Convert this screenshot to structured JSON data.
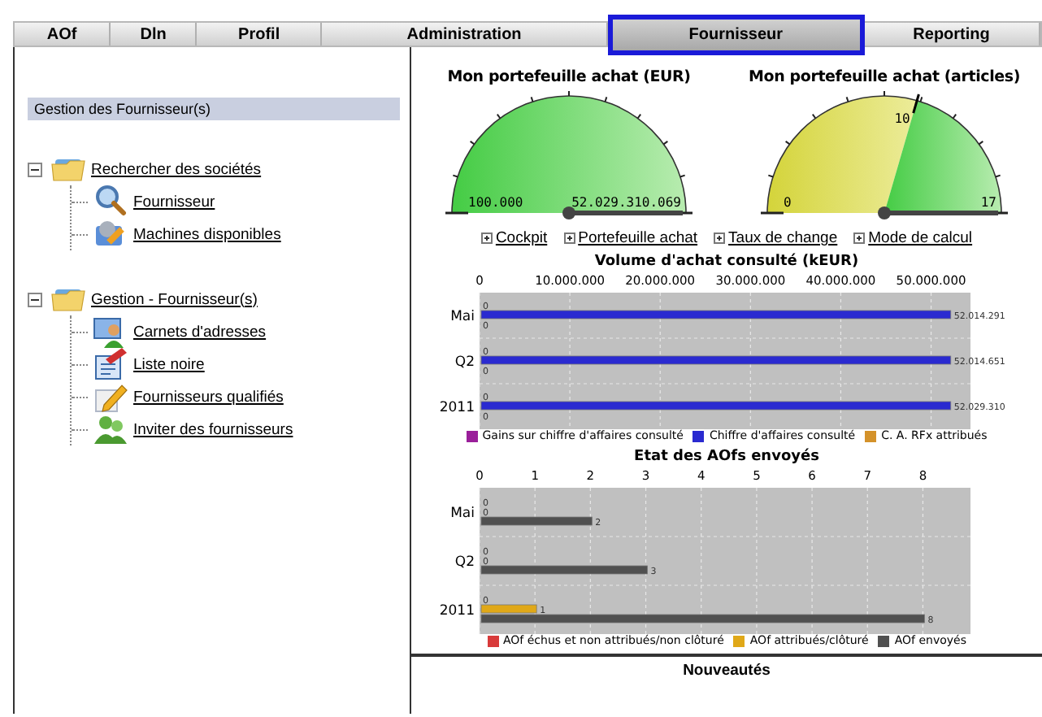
{
  "tabs": [
    {
      "label": "AOf",
      "selected": false
    },
    {
      "label": "Dln",
      "selected": false
    },
    {
      "label": "Profil",
      "selected": false
    },
    {
      "label": "Administration",
      "selected": false
    },
    {
      "label": "Fournisseur",
      "selected": true
    },
    {
      "label": "Reporting",
      "selected": false
    }
  ],
  "sidebar": {
    "title": "Gestion des Fournisseur(s)",
    "groups": [
      {
        "label": "Rechercher des sociétés",
        "expanded": true,
        "children": [
          {
            "label": "Fournisseur"
          },
          {
            "label": "Machines disponibles"
          }
        ]
      },
      {
        "label": "Gestion - Fournisseur(s)",
        "expanded": true,
        "children": [
          {
            "label": "Carnets d'adresses"
          },
          {
            "label": "Liste noire"
          },
          {
            "label": "Fournisseurs qualifiés"
          },
          {
            "label": "Inviter des fournisseurs"
          }
        ]
      }
    ]
  },
  "gauges": [
    {
      "title": "Mon portefeuille achat (EUR)",
      "min_label": "100.000",
      "max_label": "52.029.310.069"
    },
    {
      "title": "Mon portefeuille achat (articles)",
      "min_label": "0",
      "max_label": "17",
      "zone": {
        "label": "10"
      }
    }
  ],
  "links": [
    "Cockpit",
    "Portefeuille achat",
    "Taux de change",
    "Mode de calcul"
  ],
  "charts": [
    {
      "title": "Volume d'achat consulté (kEUR)",
      "chart_data": {
        "type": "bar",
        "orientation": "horizontal",
        "categories": [
          "Mai",
          "Q2",
          "2011"
        ],
        "series": [
          {
            "name": "Gains sur chiffre d'affaires consulté",
            "color": "#9a1f9a",
            "values": [
              0,
              0,
              0
            ]
          },
          {
            "name": "Chiffre d'affaires consulté",
            "color": "#2a2ad0",
            "values": [
              52000000,
              52000000,
              52000000
            ]
          },
          {
            "name": "C. A. RFx attribués",
            "color": "#d4922a",
            "values": [
              0,
              0,
              0
            ]
          }
        ],
        "grid": true,
        "xlim": [
          0,
          54000000
        ],
        "xticks": [
          {
            "value": 0,
            "label": "0"
          },
          {
            "value": 10000000,
            "label": "10.000.000"
          },
          {
            "value": 20000000,
            "label": "20.000.000"
          },
          {
            "value": 30000000,
            "label": "30.000.000"
          },
          {
            "value": 40000000,
            "label": "40.000.000"
          },
          {
            "value": 50000000,
            "label": "50.000.000"
          }
        ],
        "value_labels": [
          [
            "0",
            "0",
            "0"
          ],
          [
            "52.014.291",
            "52.014.651",
            "52.029.310"
          ],
          [
            "0",
            "0",
            "0"
          ]
        ]
      }
    },
    {
      "title": "Etat des AOfs envoyés",
      "chart_data": {
        "type": "bar",
        "orientation": "horizontal",
        "categories": [
          "Mai",
          "Q2",
          "2011"
        ],
        "series": [
          {
            "name": "AOf échus et non attribués/non clôturé",
            "color": "#d83a3a",
            "values": [
              0,
              0,
              0
            ]
          },
          {
            "name": "AOf attribués/clôturé",
            "color": "#e0a818",
            "values": [
              0,
              0,
              1
            ]
          },
          {
            "name": "AOf envoyés",
            "color": "#505050",
            "values": [
              2,
              3,
              8
            ]
          }
        ],
        "grid": true,
        "xlim": [
          0,
          8.8
        ],
        "xticks": [
          0,
          1,
          2,
          3,
          4,
          5,
          6,
          7,
          8
        ],
        "value_labels": [
          [
            "0",
            "0",
            "0"
          ],
          [
            "0",
            "0",
            "1"
          ],
          [
            "2",
            "3",
            "8"
          ]
        ]
      }
    }
  ],
  "news": {
    "title": "Nouveautés"
  }
}
